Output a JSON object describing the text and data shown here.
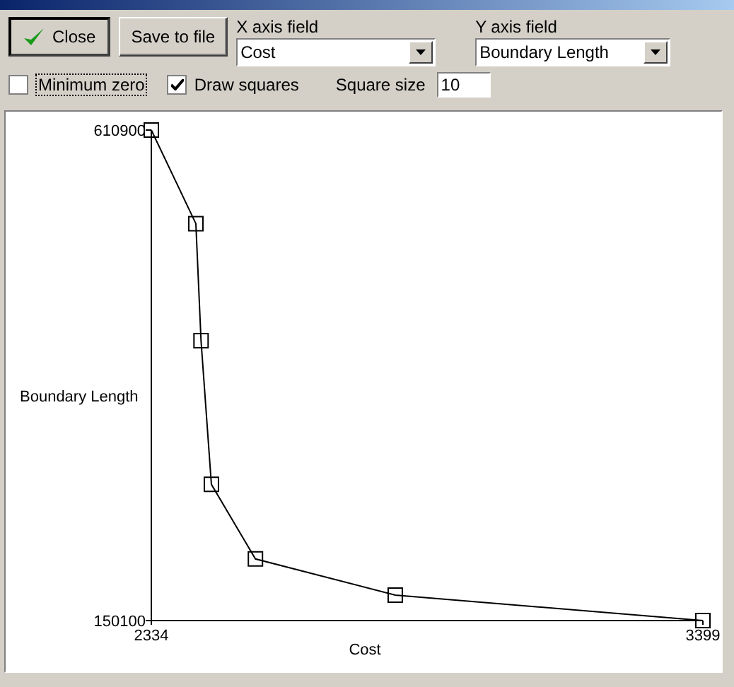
{
  "toolbar": {
    "close_button": "Close",
    "save_button": "Save to file",
    "x_axis_field": {
      "label": "X axis field",
      "value": "Cost"
    },
    "y_axis_field": {
      "label": "Y axis field",
      "value": "Boundary Length"
    },
    "minimum_zero": {
      "label": "Minimum zero",
      "checked": false
    },
    "draw_squares": {
      "label": "Draw squares",
      "checked": true
    },
    "square_size": {
      "label": "Square size",
      "value": "10"
    }
  },
  "chart": {
    "chart_data": {
      "type": "line",
      "xlabel": "Cost",
      "ylabel": "Boundary Length",
      "xlim": [
        2334,
        3399
      ],
      "ylim": [
        150100,
        610900
      ],
      "xticks": [
        2334,
        3399
      ],
      "yticks": [
        150100,
        610900
      ],
      "x": [
        2334,
        2420,
        2430,
        2450,
        2535,
        2805,
        3399
      ],
      "series": [
        {
          "color": "#000000",
          "marker": "square",
          "values": [
            610900,
            523000,
            413000,
            278000,
            208000,
            174000,
            150100
          ]
        }
      ]
    }
  }
}
